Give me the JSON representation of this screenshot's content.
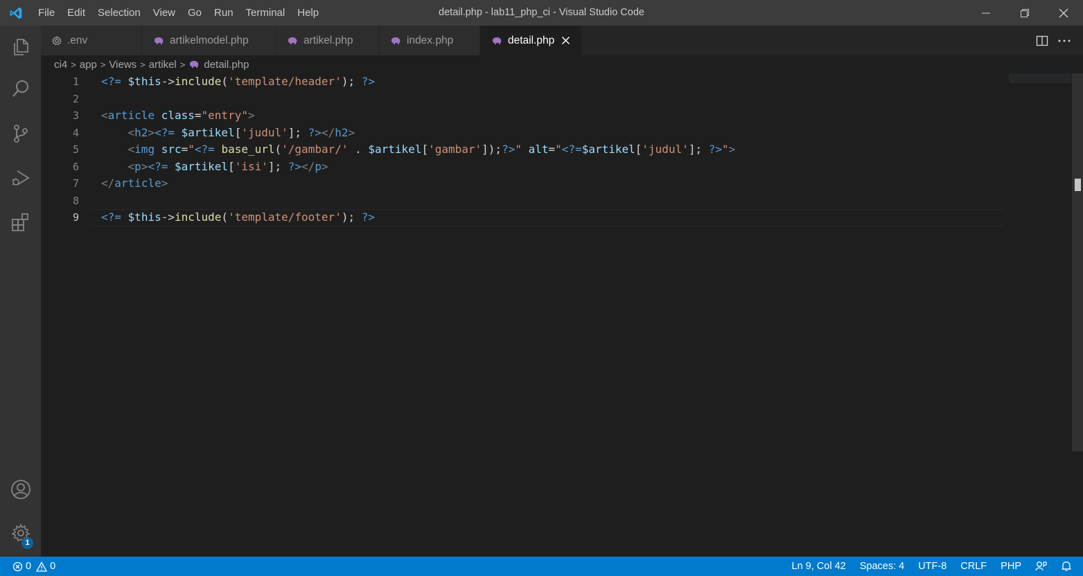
{
  "window": {
    "title": "detail.php - lab11_php_ci - Visual Studio Code",
    "menu": [
      "File",
      "Edit",
      "Selection",
      "View",
      "Go",
      "Run",
      "Terminal",
      "Help"
    ]
  },
  "tabs": [
    {
      "label": ".env",
      "icon": "gear-icon",
      "active": false
    },
    {
      "label": "artikelmodel.php",
      "icon": "php-elephant-icon",
      "active": false
    },
    {
      "label": "artikel.php",
      "icon": "php-elephant-icon",
      "active": false
    },
    {
      "label": "index.php",
      "icon": "php-elephant-icon",
      "active": false
    },
    {
      "label": "detail.php",
      "icon": "php-elephant-icon",
      "active": true
    }
  ],
  "breadcrumb": [
    "ci4",
    "app",
    "Views",
    "artikel",
    "detail.php"
  ],
  "editor": {
    "line_numbers": [
      "1",
      "2",
      "3",
      "4",
      "5",
      "6",
      "7",
      "8",
      "9"
    ],
    "current_line": 9,
    "lines": [
      [
        [
          "kw",
          "<?="
        ],
        [
          "txt",
          " "
        ],
        [
          "var",
          "$this"
        ],
        [
          "txt",
          "->"
        ],
        [
          "fn",
          "include"
        ],
        [
          "txt",
          "("
        ],
        [
          "str",
          "'template/header'"
        ],
        [
          "txt",
          "); "
        ],
        [
          "kw",
          "?>"
        ]
      ],
      [],
      [
        [
          "pun",
          "<"
        ],
        [
          "tag",
          "article"
        ],
        [
          "txt",
          " "
        ],
        [
          "attr",
          "class"
        ],
        [
          "txt",
          "="
        ],
        [
          "str",
          "\"entry\""
        ],
        [
          "pun",
          ">"
        ]
      ],
      [
        [
          "txt",
          "    "
        ],
        [
          "pun",
          "<"
        ],
        [
          "tag",
          "h2"
        ],
        [
          "pun",
          ">"
        ],
        [
          "kw",
          "<?="
        ],
        [
          "txt",
          " "
        ],
        [
          "var",
          "$artikel"
        ],
        [
          "txt",
          "["
        ],
        [
          "str",
          "'judul'"
        ],
        [
          "txt",
          "]; "
        ],
        [
          "kw",
          "?>"
        ],
        [
          "pun",
          "</"
        ],
        [
          "tag",
          "h2"
        ],
        [
          "pun",
          ">"
        ]
      ],
      [
        [
          "txt",
          "    "
        ],
        [
          "pun",
          "<"
        ],
        [
          "tag",
          "img"
        ],
        [
          "txt",
          " "
        ],
        [
          "attr",
          "src"
        ],
        [
          "txt",
          "="
        ],
        [
          "str",
          "\""
        ],
        [
          "kw",
          "<?="
        ],
        [
          "txt",
          " "
        ],
        [
          "fn",
          "base_url"
        ],
        [
          "txt",
          "("
        ],
        [
          "str",
          "'/gambar/'"
        ],
        [
          "txt",
          " . "
        ],
        [
          "var",
          "$artikel"
        ],
        [
          "txt",
          "["
        ],
        [
          "str",
          "'gambar'"
        ],
        [
          "txt",
          "]);"
        ],
        [
          "kw",
          "?>"
        ],
        [
          "str",
          "\""
        ],
        [
          "txt",
          " "
        ],
        [
          "attr",
          "alt"
        ],
        [
          "txt",
          "="
        ],
        [
          "str",
          "\""
        ],
        [
          "kw",
          "<?="
        ],
        [
          "var",
          "$artikel"
        ],
        [
          "txt",
          "["
        ],
        [
          "str",
          "'judul'"
        ],
        [
          "txt",
          "]; "
        ],
        [
          "kw",
          "?>"
        ],
        [
          "str",
          "\""
        ],
        [
          "pun",
          ">"
        ]
      ],
      [
        [
          "txt",
          "    "
        ],
        [
          "pun",
          "<"
        ],
        [
          "tag",
          "p"
        ],
        [
          "pun",
          ">"
        ],
        [
          "kw",
          "<?="
        ],
        [
          "txt",
          " "
        ],
        [
          "var",
          "$artikel"
        ],
        [
          "txt",
          "["
        ],
        [
          "str",
          "'isi'"
        ],
        [
          "txt",
          "]; "
        ],
        [
          "kw",
          "?>"
        ],
        [
          "pun",
          "</"
        ],
        [
          "tag",
          "p"
        ],
        [
          "pun",
          ">"
        ]
      ],
      [
        [
          "pun",
          "</"
        ],
        [
          "tag",
          "article"
        ],
        [
          "pun",
          ">"
        ]
      ],
      [],
      [
        [
          "kw",
          "<?="
        ],
        [
          "txt",
          " "
        ],
        [
          "var",
          "$this"
        ],
        [
          "txt",
          "->"
        ],
        [
          "fn",
          "include"
        ],
        [
          "txt",
          "("
        ],
        [
          "str",
          "'template/footer'"
        ],
        [
          "txt",
          "); "
        ],
        [
          "kw",
          "?>"
        ]
      ]
    ]
  },
  "statusbar": {
    "errors": "0",
    "warnings": "0",
    "position": "Ln 9, Col 42",
    "spaces": "Spaces: 4",
    "encoding": "UTF-8",
    "eol": "CRLF",
    "language": "PHP"
  },
  "activitybar": {
    "items": [
      "explorer-icon",
      "search-icon",
      "source-control-icon",
      "run-debug-icon",
      "extensions-icon",
      "accounts-icon",
      "settings-gear-icon"
    ],
    "settings_badge": "1"
  },
  "colors": {
    "accent": "#007acc",
    "editor_bg": "#1e1e1e",
    "php_icon": "#a074c4"
  }
}
